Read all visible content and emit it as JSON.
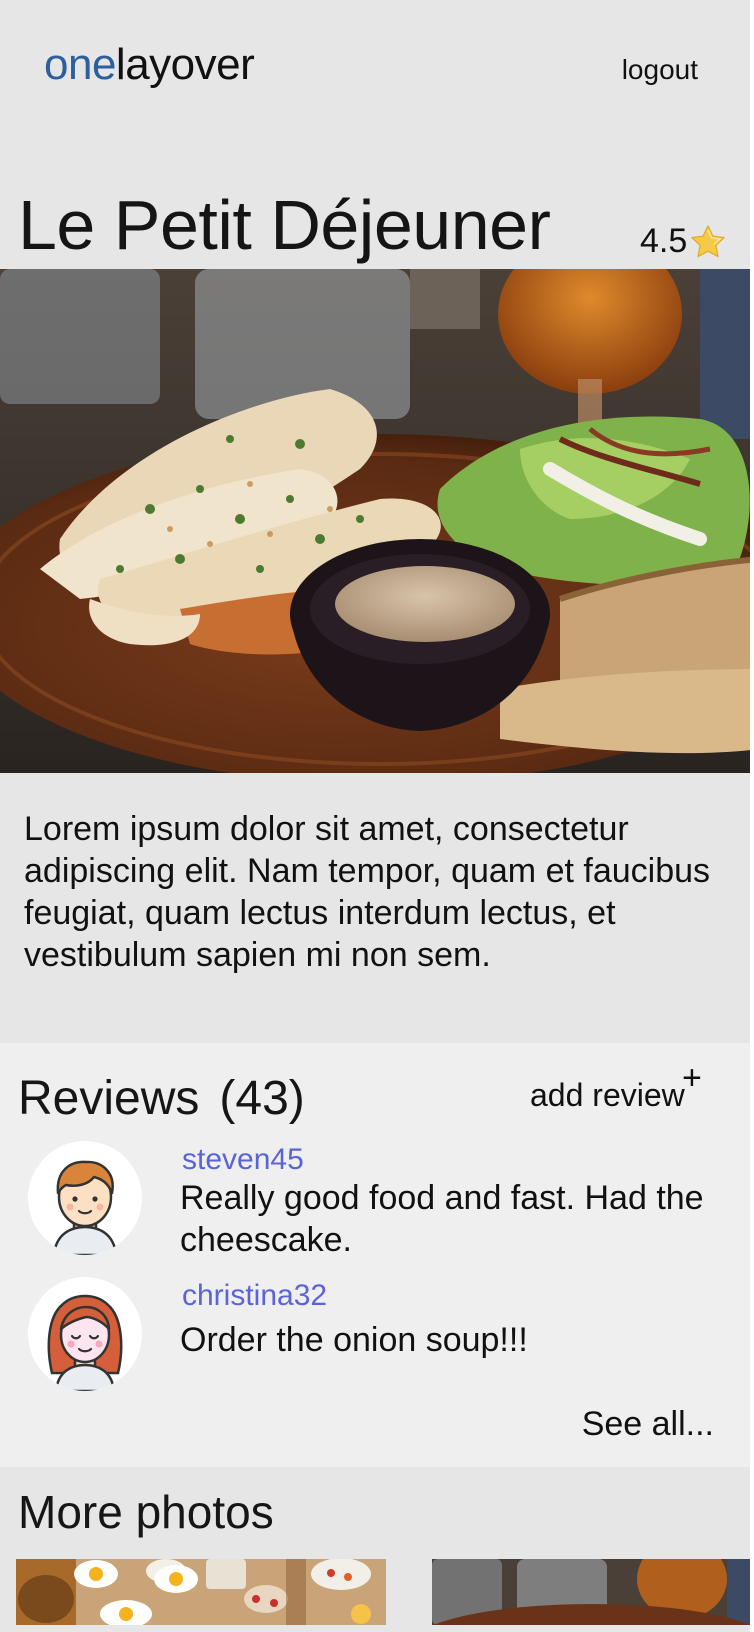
{
  "header": {
    "logo_part1": "one",
    "logo_part2": "layover",
    "logout_label": "logout"
  },
  "restaurant": {
    "name": "Le Petit Déjeuner",
    "rating": "4.5",
    "description": "Lorem ipsum dolor sit amet, consectetur adipiscing elit. Nam tempor, quam et faucibus feugiat, quam lectus interdum lectus, et vestibulum sapien mi non sem."
  },
  "reviews": {
    "title": "Reviews",
    "count": "(43)",
    "add_label": "add review",
    "add_icon": "+",
    "see_all_label": "See all...",
    "items": [
      {
        "username": "steven45",
        "text": "Really good food and fast. Had the cheescake."
      },
      {
        "username": "christina32",
        "text": "Order the onion soup!!!"
      }
    ]
  },
  "more_photos": {
    "title": "More photos"
  },
  "colors": {
    "brand_blue": "#2c5f9e",
    "username_color": "#5a63d8",
    "star": "#f7c948"
  }
}
